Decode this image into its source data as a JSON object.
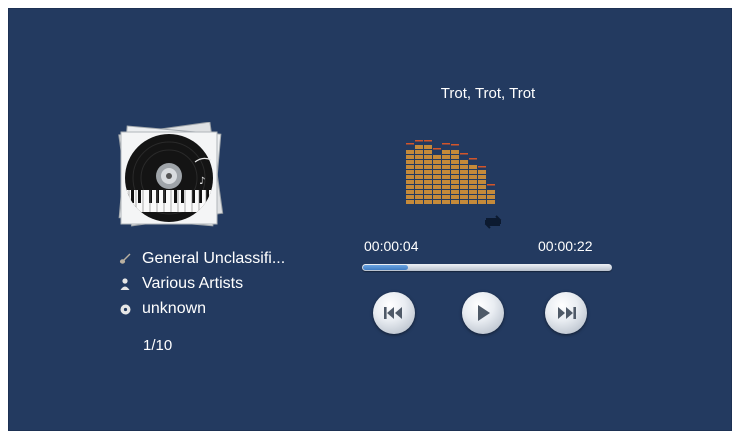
{
  "player": {
    "track_title": "Trot, Trot, Trot",
    "genre": "General Unclassifi...",
    "artist": "Various Artists",
    "album": "unknown",
    "track_index": "1/10",
    "elapsed": "00:00:04",
    "duration": "00:00:22",
    "progress": 0.18
  },
  "icons": {
    "genre": "guitar-icon",
    "artist": "person-icon",
    "album": "disc-icon",
    "repeat": "repeat-icon",
    "prev": "skip-previous-icon",
    "play": "play-icon",
    "next": "skip-next-icon"
  },
  "colors": {
    "background": "#233a60",
    "equalizer_bar": "#c58a3a",
    "equalizer_peak": "#d2552a",
    "progress_fill": "#3f7cc4",
    "button_glyph": "#4f5a68"
  },
  "equalizer": {
    "levels": [
      0.86,
      0.9,
      0.9,
      0.78,
      0.86,
      0.84,
      0.7,
      0.62,
      0.5,
      0.22
    ]
  }
}
